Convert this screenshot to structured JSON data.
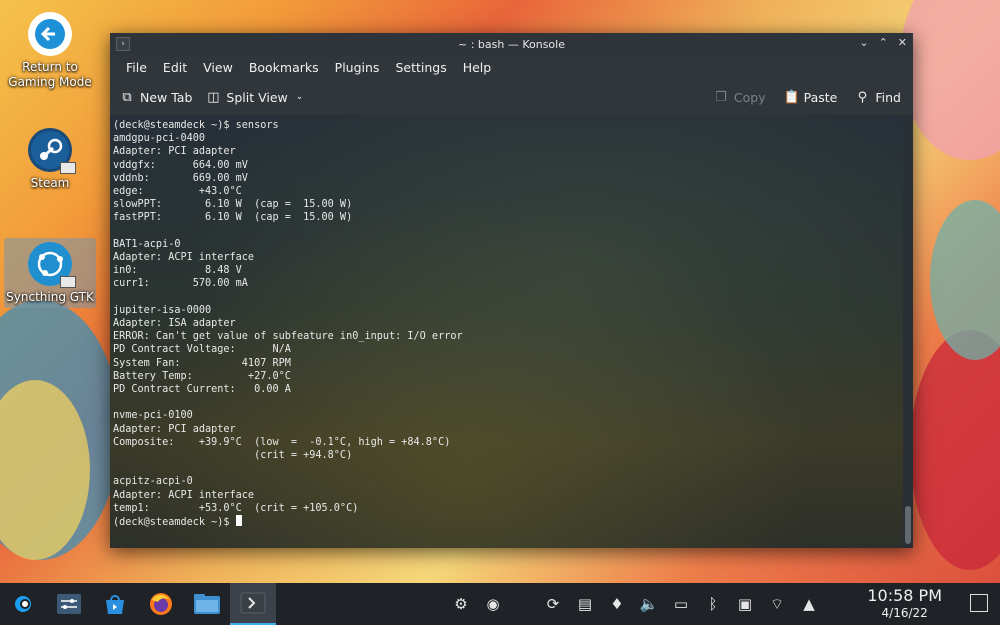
{
  "desktop": {
    "icons": [
      {
        "label": "Return to\nGaming Mode",
        "icon": "return-arrow-icon"
      },
      {
        "label": "Steam",
        "icon": "steam-icon"
      },
      {
        "label": "Syncthing GTK",
        "icon": "syncthing-icon"
      }
    ]
  },
  "window": {
    "title": "~ : bash — Konsole",
    "menu": [
      "File",
      "Edit",
      "View",
      "Bookmarks",
      "Plugins",
      "Settings",
      "Help"
    ],
    "toolbar": {
      "new_tab": "New Tab",
      "split_view": "Split View",
      "copy": "Copy",
      "paste": "Paste",
      "find": "Find"
    }
  },
  "terminal": {
    "lines": [
      "(deck@steamdeck ~)$ sensors",
      "amdgpu-pci-0400",
      "Adapter: PCI adapter",
      "vddgfx:      664.00 mV",
      "vddnb:       669.00 mV",
      "edge:         +43.0°C",
      "slowPPT:       6.10 W  (cap =  15.00 W)",
      "fastPPT:       6.10 W  (cap =  15.00 W)",
      "",
      "BAT1-acpi-0",
      "Adapter: ACPI interface",
      "in0:           8.48 V",
      "curr1:       570.00 mA",
      "",
      "jupiter-isa-0000",
      "Adapter: ISA adapter",
      "ERROR: Can't get value of subfeature in0_input: I/O error",
      "PD Contract Voltage:      N/A",
      "System Fan:          4107 RPM",
      "Battery Temp:         +27.0°C",
      "PD Contract Current:   0.00 A",
      "",
      "nvme-pci-0100",
      "Adapter: PCI adapter",
      "Composite:    +39.9°C  (low  =  -0.1°C, high = +84.8°C)",
      "                       (crit = +94.8°C)",
      "",
      "acpitz-acpi-0",
      "Adapter: ACPI interface",
      "temp1:        +53.0°C  (crit = +105.0°C)",
      ""
    ],
    "prompt": "(deck@steamdeck ~)$ "
  },
  "taskbar": {
    "apps": [
      "launcher-icon",
      "system-settings-icon",
      "discover-store-icon",
      "firefox-icon",
      "dolphin-files-icon",
      "konsole-icon"
    ],
    "tray": [
      "steam-input-icon",
      "steam-tray-icon",
      "update-icon",
      "clipboard-icon",
      "notifications-icon",
      "volume-icon",
      "battery-icon",
      "bluetooth-icon",
      "storage-icon",
      "wifi-icon",
      "expand-tray-icon"
    ],
    "time": "10:58 PM",
    "date": "4/16/22"
  }
}
